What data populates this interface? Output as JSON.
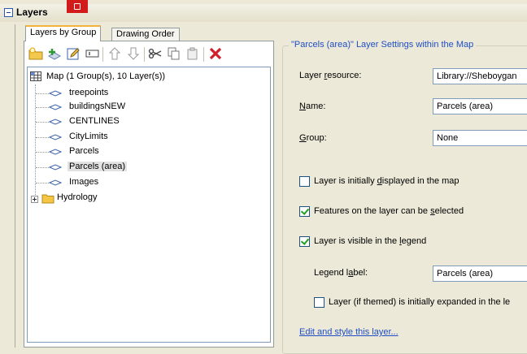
{
  "panel": {
    "title": "Layers"
  },
  "tabs": [
    {
      "label": "Layers by Group",
      "active": true
    },
    {
      "label": "Drawing Order",
      "active": false
    }
  ],
  "toolbar": {
    "icons": [
      "add-group-icon",
      "add-layer-icon",
      "edit-icon",
      "rename-icon",
      "move-up-icon",
      "move-down-icon",
      "cut-icon",
      "copy-icon",
      "paste-icon",
      "delete-icon"
    ]
  },
  "tree": {
    "root": "Map (1 Group(s), 10 Layer(s))",
    "layers": [
      "treepoints",
      "buildingsNEW",
      "CENTLINES",
      "CityLimits",
      "Parcels",
      "Parcels (area)",
      "Images"
    ],
    "selected_layer": "Parcels (area)",
    "group": "Hydrology"
  },
  "settings": {
    "group_title": "\"Parcels (area)\" Layer Settings within the Map",
    "resource_label_pre": "Layer ",
    "resource_label_key": "r",
    "resource_label_post": "esource:",
    "resource_value": "Library://Sheboygan",
    "name_label_key": "N",
    "name_label_post": "ame:",
    "name_value": "Parcels (area)",
    "group_label_key": "G",
    "group_label_post": "roup:",
    "group_value": "None",
    "cb_displayed_pre": "Layer is initially ",
    "cb_displayed_key": "d",
    "cb_displayed_post": "isplayed in the map",
    "cb_displayed_checked": false,
    "cb_selectable_pre": "Features on the layer can be ",
    "cb_selectable_key": "s",
    "cb_selectable_post": "elected",
    "cb_selectable_checked": true,
    "cb_legend_pre": "Layer is visible in the ",
    "cb_legend_key": "l",
    "cb_legend_post": "egend",
    "cb_legend_checked": true,
    "legend_label_pre": "Legend l",
    "legend_label_key": "a",
    "legend_label_post": "bel:",
    "legend_value": "Parcels (area)",
    "cb_expanded_label": "Layer (if themed) is initially expanded in the le",
    "cb_expanded_checked": false,
    "edit_link": "Edit and style this layer..."
  },
  "colors": {
    "accent_blue": "#1f4ec4",
    "tab_highlight": "#f2b23c",
    "delete_red": "#d0202a",
    "check_green": "#21a121"
  }
}
